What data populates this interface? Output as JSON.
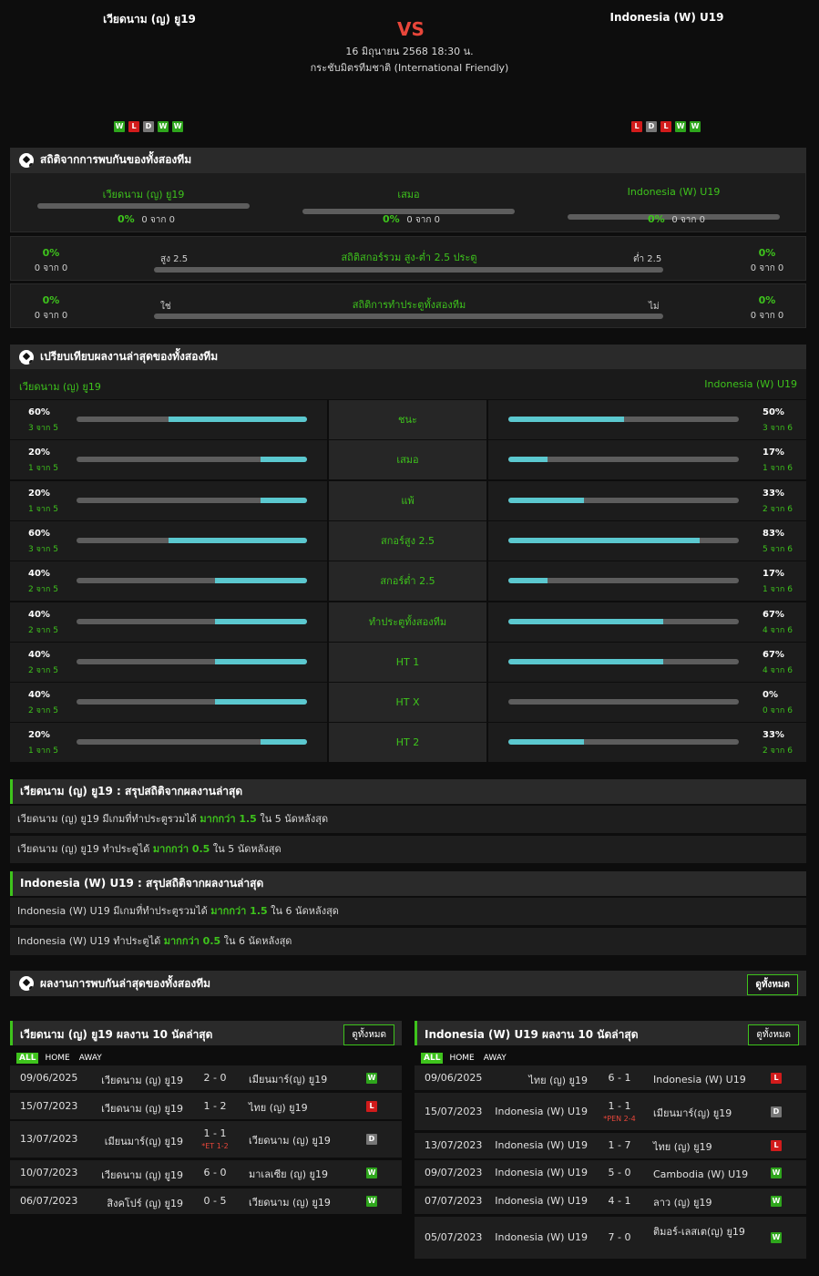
{
  "header": {
    "home_team": "เวียดนาม (ญ) ยู19",
    "away_team": "Indonesia (W) U19",
    "vs": "VS",
    "datetime": "16 มิถุนายน 2568 18:30 น.",
    "competition": "กระชับมิตรทีมชาติ (International Friendly)",
    "home_form": [
      "W",
      "L",
      "D",
      "W",
      "W"
    ],
    "away_form": [
      "L",
      "D",
      "L",
      "W",
      "W"
    ]
  },
  "h2h": {
    "title": "สถิติจากการพบกันของทั้งสองทีม",
    "cols": [
      {
        "label": "เวียดนาม (ญ) ยู19",
        "pct": "0%",
        "sub": "0 จาก 0"
      },
      {
        "label": "เสมอ",
        "pct": "0%",
        "sub": "0 จาก 0"
      },
      {
        "label": "Indonesia (W) U19",
        "pct": "0%",
        "sub": "0 จาก 0"
      }
    ],
    "ou": {
      "title": "สถิติสกอร์รวม สูง-ต่ำ 2.5 ประตู",
      "left_label": "สูง 2.5",
      "right_label": "ต่ำ 2.5",
      "left_pct": "0%",
      "left_sub": "0 จาก 0",
      "right_pct": "0%",
      "right_sub": "0 จาก 0"
    },
    "btts": {
      "title": "สถิติการทำประตูทั้งสองทีม",
      "left_label": "ใช่",
      "right_label": "ไม่",
      "left_pct": "0%",
      "left_sub": "0 จาก 0",
      "right_pct": "0%",
      "right_sub": "0 จาก 0"
    }
  },
  "compare": {
    "title": "เปรียบเทียบผลงานล่าสุดของทั้งสองทีม",
    "home_label": "เวียดนาม (ญ) ยู19",
    "away_label": "Indonesia (W) U19",
    "rows": [
      {
        "label": "ชนะ",
        "hp": "60%",
        "hs": "3 จาก 5",
        "hv": 0.6,
        "ap": "50%",
        "as": "3 จาก 6",
        "av": 0.5
      },
      {
        "label": "เสมอ",
        "hp": "20%",
        "hs": "1 จาก 5",
        "hv": 0.2,
        "ap": "17%",
        "as": "1 จาก 6",
        "av": 0.17
      },
      {
        "label": "แพ้",
        "hp": "20%",
        "hs": "1 จาก 5",
        "hv": 0.2,
        "ap": "33%",
        "as": "2 จาก 6",
        "av": 0.33
      },
      {
        "label": "สกอร์สูง 2.5",
        "hp": "60%",
        "hs": "3 จาก 5",
        "hv": 0.6,
        "ap": "83%",
        "as": "5 จาก 6",
        "av": 0.83
      },
      {
        "label": "สกอร์ต่ำ 2.5",
        "hp": "40%",
        "hs": "2 จาก 5",
        "hv": 0.4,
        "ap": "17%",
        "as": "1 จาก 6",
        "av": 0.17
      },
      {
        "label": "ทำประตูทั้งสองทีม",
        "hp": "40%",
        "hs": "2 จาก 5",
        "hv": 0.4,
        "ap": "67%",
        "as": "4 จาก 6",
        "av": 0.67
      },
      {
        "label": "HT 1",
        "hp": "40%",
        "hs": "2 จาก 5",
        "hv": 0.4,
        "ap": "67%",
        "as": "4 จาก 6",
        "av": 0.67
      },
      {
        "label": "HT X",
        "hp": "40%",
        "hs": "2 จาก 5",
        "hv": 0.4,
        "ap": "0%",
        "as": "0 จาก 6",
        "av": 0
      },
      {
        "label": "HT 2",
        "hp": "20%",
        "hs": "1 จาก 5",
        "hv": 0.2,
        "ap": "33%",
        "as": "2 จาก 6",
        "av": 0.33
      }
    ]
  },
  "summary_home": {
    "title": "เวียดนาม (ญ) ยู19 : สรุปสถิติจากผลงานล่าสุด",
    "line1_a": "เวียดนาม (ญ) ยู19  มีเกมที่ทำประตูรวมได้ ",
    "line1_b": "มากกว่า  1.5",
    "line1_c": "  ใน 5 นัดหลังสุด",
    "line2_a": "เวียดนาม (ญ) ยู19  ทำประตูได้  ",
    "line2_b": "มากกว่า  0.5",
    "line2_c": "  ใน 5 นัดหลังสุด"
  },
  "summary_away": {
    "title": "Indonesia (W) U19 : สรุปสถิติจากผลงานล่าสุด",
    "line1_a": "Indonesia (W) U19  มีเกมที่ทำประตูรวมได้  ",
    "line1_b": "มากกว่า  1.5",
    "line1_c": "  ใน 6 นัดหลังสุด",
    "line2_a": "Indonesia (W) U19  ทำประตูได้  ",
    "line2_b": "มากกว่า  0.5",
    "line2_c": "  ใน 6 นัดหลังสุด"
  },
  "recent": {
    "title": "ผลงานการพบกันล่าสุดของทั้งสองทีม",
    "view_all": "ดูทั้งหมด",
    "tabs": [
      "ALL",
      "HOME",
      "AWAY"
    ],
    "home": {
      "title": "เวียดนาม (ญ) ยู19 ผลงาน 10 นัดล่าสุด",
      "matches": [
        {
          "date": "09/06/2025",
          "home": "เวียดนาม (ญ) ยู19",
          "score": "2 - 0",
          "note": "",
          "away": "เมียนมาร์(ญ) ยู19",
          "res": "W"
        },
        {
          "date": "15/07/2023",
          "home": "เวียดนาม (ญ) ยู19",
          "score": "1 - 2",
          "note": "",
          "away": "ไทย (ญ) ยู19",
          "res": "L"
        },
        {
          "date": "13/07/2023",
          "home": "เมียนมาร์(ญ) ยู19",
          "score": "1 - 1",
          "note": "*ET 1-2",
          "away": "เวียดนาม (ญ) ยู19",
          "res": "D"
        },
        {
          "date": "10/07/2023",
          "home": "เวียดนาม (ญ) ยู19",
          "score": "6 - 0",
          "note": "",
          "away": "มาเลเซีย (ญ) ยู19",
          "res": "W"
        },
        {
          "date": "06/07/2023",
          "home": "สิงคโปร์ (ญ) ยู19",
          "score": "0 - 5",
          "note": "",
          "away": "เวียดนาม (ญ) ยู19",
          "res": "W"
        }
      ]
    },
    "away": {
      "title": "Indonesia (W) U19 ผลงาน 10 นัดล่าสุด",
      "matches": [
        {
          "date": "09/06/2025",
          "home": "ไทย (ญ) ยู19",
          "score": "6 - 1",
          "note": "",
          "away": "Indonesia (W) U19",
          "res": "L"
        },
        {
          "date": "15/07/2023",
          "home": "Indonesia (W) U19",
          "score": "1 - 1",
          "note": "*PEN 2-4",
          "away": "เมียนมาร์(ญ) ยู19",
          "res": "D"
        },
        {
          "date": "13/07/2023",
          "home": "Indonesia (W) U19",
          "score": "1 - 7",
          "note": "",
          "away": "ไทย (ญ) ยู19",
          "res": "L"
        },
        {
          "date": "09/07/2023",
          "home": "Indonesia (W) U19",
          "score": "5 - 0",
          "note": "",
          "away": "Cambodia (W) U19",
          "res": "W"
        },
        {
          "date": "07/07/2023",
          "home": "Indonesia (W) U19",
          "score": "4 - 1",
          "note": "",
          "away": "ลาว (ญ) ยู19",
          "res": "W"
        },
        {
          "date": "05/07/2023",
          "home": "Indonesia (W) U19",
          "score": "7 - 0",
          "note": "",
          "away": "ติมอร์-เลสเต(ญ) ยู19",
          "res": "W"
        }
      ]
    }
  }
}
